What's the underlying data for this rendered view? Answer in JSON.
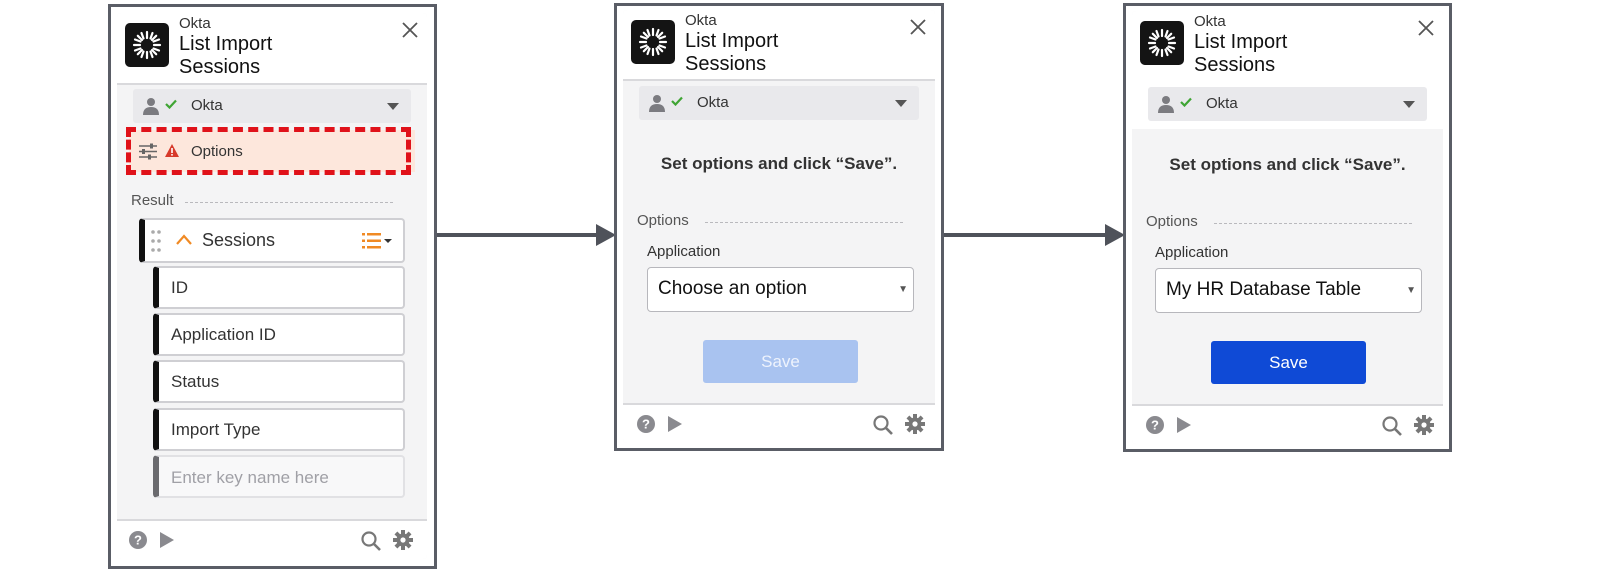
{
  "colors": {
    "frame_border": "#5a5d66",
    "highlight_dash": "#e0121a",
    "options_warning_bg": "#fde7dc",
    "warning_icon": "#d73a2b",
    "check": "#3fa534",
    "save_disabled": "#a9c3f0",
    "save_enabled": "#0f4ad6",
    "list_icon": "#f08a24"
  },
  "panel1": {
    "vendor": "Okta",
    "title_line1": "List Import",
    "title_line2": "Sessions",
    "connection_label": "Okta",
    "options_label": "Options",
    "result_label": "Result",
    "sessions_label": "Sessions",
    "fields": [
      "ID",
      "Application ID",
      "Status",
      "Import Type"
    ],
    "key_placeholder": "Enter key name here"
  },
  "panel2": {
    "vendor": "Okta",
    "title_line1": "List Import",
    "title_line2": "Sessions",
    "connection_label": "Okta",
    "message": "Set options and click “Save”.",
    "options_label": "Options",
    "application_label": "Application",
    "application_value": "Choose an option",
    "save_label": "Save"
  },
  "panel3": {
    "vendor": "Okta",
    "title_line1": "List Import",
    "title_line2": "Sessions",
    "connection_label": "Okta",
    "message": "Set options and click “Save”.",
    "options_label": "Options",
    "application_label": "Application",
    "application_value": "My HR Database Table",
    "save_label": "Save"
  }
}
